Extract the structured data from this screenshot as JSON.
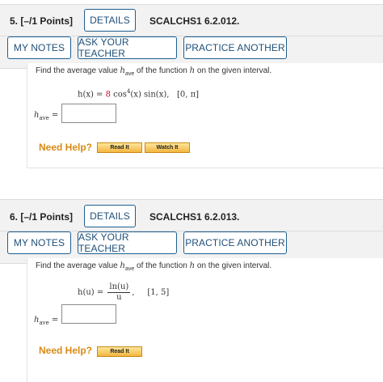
{
  "problems": [
    {
      "number": "5.",
      "points": "[–/1 Points]",
      "details_label": "DETAILS",
      "code": "SCALCHS1 6.2.012.",
      "my_notes_label": "MY NOTES",
      "ask_teacher_label": "ASK YOUR TEACHER",
      "practice_label": "PRACTICE ANOTHER",
      "instruction_pre": "Find the average value",
      "instruction_var": "h",
      "instruction_sub": "ave",
      "instruction_post": "of the function",
      "instruction_var2": "h",
      "instruction_end": "on the given interval.",
      "formula_lhs": "h(x) = ",
      "formula_coef": "8",
      "formula_rest_a": " cos",
      "formula_exp": "4",
      "formula_rest_b": "(x) sin(x),",
      "formula_interval": "[0, π]",
      "answer_var": "h",
      "answer_sub": "ave",
      "answer_eq": " =",
      "answer_value": "",
      "need_help": "Need Help?",
      "read_it": "Read It",
      "watch_it": "Watch It"
    },
    {
      "number": "6.",
      "points": "[–/1 Points]",
      "details_label": "DETAILS",
      "code": "SCALCHS1 6.2.013.",
      "my_notes_label": "MY NOTES",
      "ask_teacher_label": "ASK YOUR TEACHER",
      "practice_label": "PRACTICE ANOTHER",
      "instruction_pre": "Find the average value",
      "instruction_var": "h",
      "instruction_sub": "ave",
      "instruction_post": "of the function",
      "instruction_var2": "h",
      "instruction_end": "on the given interval.",
      "formula_lhs": "h(u) = ",
      "formula_num": "ln(u)",
      "formula_den": "u",
      "formula_comma": ",",
      "formula_interval": "[1, 5]",
      "answer_var": "h",
      "answer_sub": "ave",
      "answer_eq": " =",
      "answer_value": "",
      "need_help": "Need Help?",
      "read_it": "Read It"
    }
  ],
  "colors": {
    "button_border": "#1f5f8f",
    "button_text": "#1f4f78",
    "need_help": "#d98a14",
    "highlight_red": "#c8102e",
    "band_bg": "#f2f2f2"
  }
}
